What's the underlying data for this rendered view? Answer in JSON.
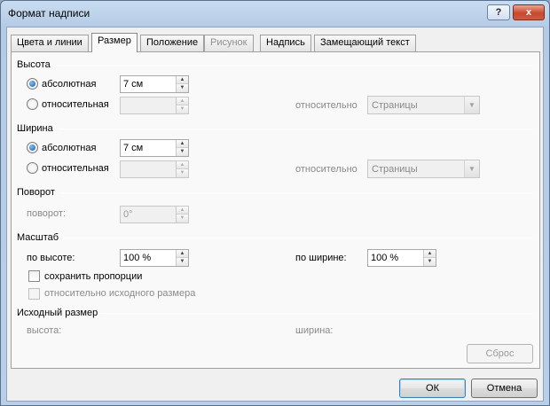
{
  "window": {
    "title": "Формат надписи",
    "help_glyph": "?",
    "close_glyph": "x"
  },
  "tabs": [
    {
      "label": "Цвета и линии",
      "active": false,
      "disabled": false
    },
    {
      "label": "Размер",
      "active": true,
      "disabled": false
    },
    {
      "label": "Положение",
      "active": false,
      "disabled": false
    },
    {
      "label": "Рисунок",
      "active": false,
      "disabled": true
    },
    {
      "label": "Надпись",
      "active": false,
      "disabled": false
    },
    {
      "label": "Замещающий текст",
      "active": false,
      "disabled": false
    }
  ],
  "height": {
    "section": "Высота",
    "absolute_label": "абсолютная",
    "absolute_value": "7 см",
    "relative_label": "относительная",
    "relative_value": "",
    "relative_to_label": "относительно",
    "relative_to_value": "Страницы",
    "selected": "absolute"
  },
  "width": {
    "section": "Ширина",
    "absolute_label": "абсолютная",
    "absolute_value": "7 см",
    "relative_label": "относительная",
    "relative_value": "",
    "relative_to_label": "относительно",
    "relative_to_value": "Страницы",
    "selected": "absolute"
  },
  "rotation": {
    "section": "Поворот",
    "label": "поворот:",
    "value": "0°"
  },
  "scale": {
    "section": "Масштаб",
    "height_label": "по высоте:",
    "height_value": "100 %",
    "width_label": "по ширине:",
    "width_value": "100 %",
    "lock_label": "сохранить пропорции",
    "lock_checked": false,
    "relative_original_label": "относительно исходного размера",
    "relative_original_checked": false
  },
  "original_size": {
    "section": "Исходный размер",
    "height_label": "высота:",
    "width_label": "ширина:",
    "reset_label": "Сброс"
  },
  "footer": {
    "ok_label": "ОК",
    "cancel_label": "Отмена"
  },
  "icons": {
    "spin_up": "▲",
    "spin_down": "▼",
    "dropdown": "▼"
  }
}
